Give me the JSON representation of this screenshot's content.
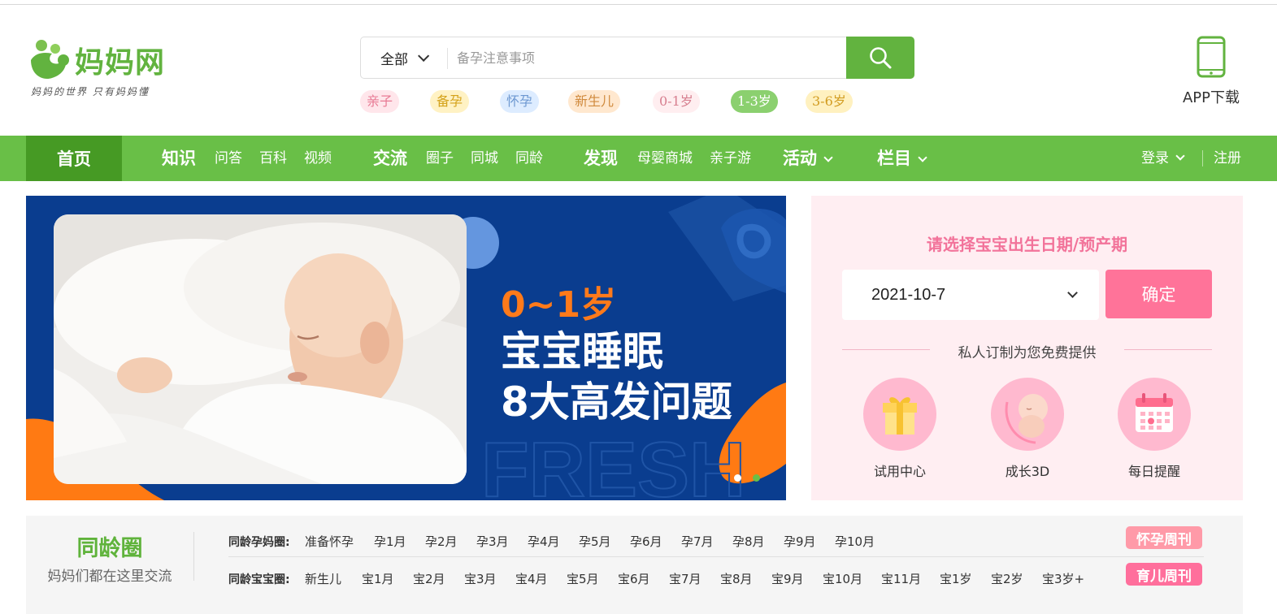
{
  "logo": {
    "name": "妈妈网",
    "slogan": "妈妈的世界 只有妈妈懂"
  },
  "search": {
    "scope": "全部",
    "placeholder": "备孕注意事项"
  },
  "hot_tags": [
    {
      "label": "亲子",
      "bg": "#ffe6eb",
      "color": "#e87a94"
    },
    {
      "label": "备孕",
      "bg": "#fff2c4",
      "color": "#d4a21a"
    },
    {
      "label": "怀孕",
      "bg": "#ddecff",
      "color": "#6c97d0"
    },
    {
      "label": "新生儿",
      "bg": "#ffe8cf",
      "color": "#d08a3d"
    },
    {
      "label": "0-1岁",
      "bg": "#ffeef0",
      "color": "#d77f8f"
    },
    {
      "label": "1-3岁",
      "bg": "#8bd06f",
      "color": "#ffffff"
    },
    {
      "label": "3-6岁",
      "bg": "#fff1c0",
      "color": "#d29c20"
    }
  ],
  "app_download": "APP下载",
  "nav": {
    "home": "首页",
    "knowledge": "知识",
    "qa": "问答",
    "wiki": "百科",
    "video": "视频",
    "social": "交流",
    "circle": "圈子",
    "city": "同城",
    "age": "同龄",
    "discover": "发现",
    "mall": "母婴商城",
    "trip": "亲子游",
    "activity": "活动",
    "column": "栏目",
    "login": "登录",
    "register": "注册"
  },
  "banner": {
    "line1": "0~1岁",
    "line2": "宝宝睡眠",
    "line3": "8大高发问题",
    "watermark": "FRESH"
  },
  "date_panel": {
    "title": "请选择宝宝出生日期/预产期",
    "date_value": "2021-10-7",
    "confirm": "确定",
    "subtitle": "私人订制为您免费提供",
    "services": [
      {
        "label": "试用中心",
        "icon": "gift-icon"
      },
      {
        "label": "成长3D",
        "icon": "fetus-icon"
      },
      {
        "label": "每日提醒",
        "icon": "calendar-icon"
      }
    ]
  },
  "peer_circle": {
    "title": "同龄圈",
    "subtitle": "妈妈们都在这里交流",
    "pregnancy_label": "同龄孕妈圈:",
    "pregnancy_links": [
      "准备怀孕",
      "孕1月",
      "孕2月",
      "孕3月",
      "孕4月",
      "孕5月",
      "孕6月",
      "孕7月",
      "孕8月",
      "孕9月",
      "孕10月"
    ],
    "baby_label": "同龄宝宝圈:",
    "baby_links": [
      "新生儿",
      "宝1月",
      "宝2月",
      "宝3月",
      "宝4月",
      "宝5月",
      "宝6月",
      "宝7月",
      "宝8月",
      "宝9月",
      "宝10月",
      "宝11月",
      "宝1岁",
      "宝2岁",
      "宝3岁+"
    ],
    "pregnancy_weekly": "怀孕周刊",
    "parenting_weekly": "育儿周刊"
  },
  "colors": {
    "brand_green": "#62b33f",
    "nav_green": "#69bf47",
    "pink": "#ff7399"
  }
}
